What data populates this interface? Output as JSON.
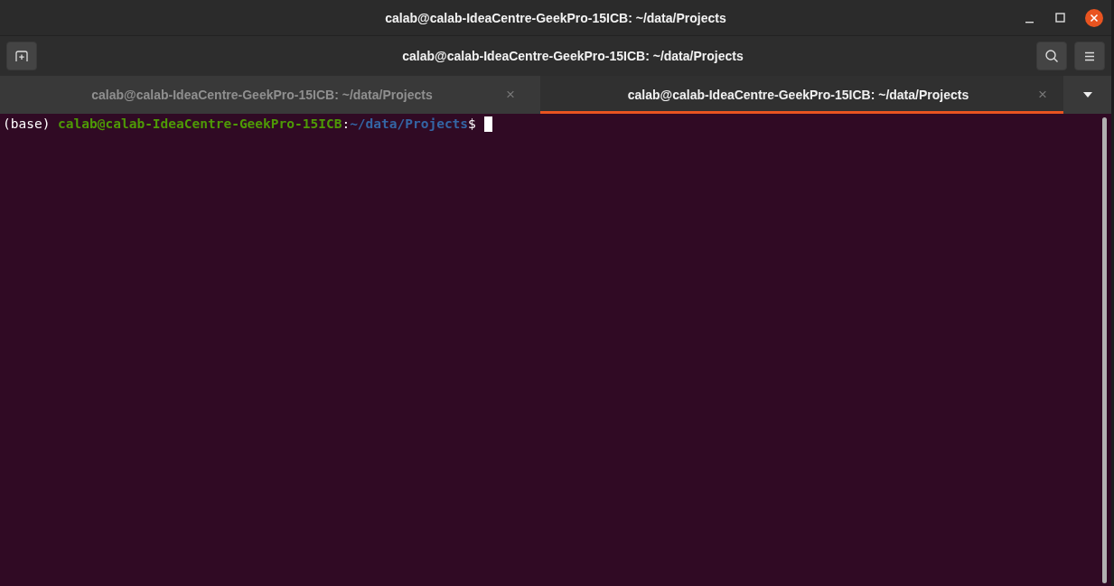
{
  "window": {
    "title": "calab@calab-IdeaCentre-GeekPro-15ICB: ~/data/Projects"
  },
  "header_bar": {
    "title": "calab@calab-IdeaCentre-GeekPro-15ICB: ~/data/Projects"
  },
  "tabs": [
    {
      "label": "calab@calab-IdeaCentre-GeekPro-15ICB: ~/data/Projects",
      "close": "×",
      "selected": false
    },
    {
      "label": "calab@calab-IdeaCentre-GeekPro-15ICB: ~/data/Projects",
      "close": "×",
      "selected": true
    }
  ],
  "terminal": {
    "lines": [
      {
        "segments": [
          {
            "kind": "plain",
            "text": "(base) "
          },
          {
            "kind": "user",
            "text": "calab@calab-IdeaCentre-GeekPro-15ICB"
          },
          {
            "kind": "plain",
            "text": ":"
          },
          {
            "kind": "path",
            "text": "~/data/Projects"
          },
          {
            "kind": "plain",
            "text": "$ "
          }
        ],
        "cursor": true
      }
    ]
  }
}
